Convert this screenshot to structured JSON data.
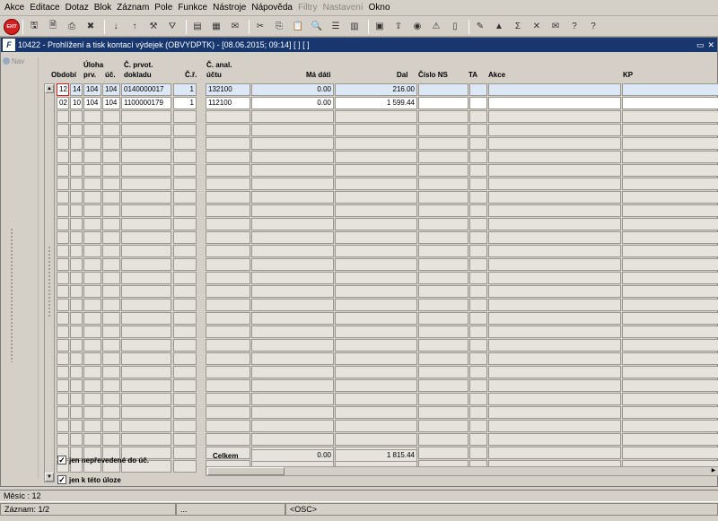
{
  "menu": [
    "Akce",
    "Editace",
    "Dotaz",
    "Blok",
    "Záznam",
    "Pole",
    "Funkce",
    "Nástroje",
    "Nápověda",
    "Filtry",
    "Nastavení",
    "Okno"
  ],
  "menu_disabled": [
    "Filtry",
    "Nastavení"
  ],
  "toolbar": {
    "exit_label": "EXIT",
    "icons": [
      "save-icon",
      "save-record-icon",
      "print-icon",
      "delete-icon",
      "sort-asc-icon",
      "sort-desc-icon",
      "tools-icon",
      "filter-icon",
      "document-icon",
      "document2-icon",
      "email-icon",
      "cut-icon",
      "copy-icon",
      "paste-icon",
      "zoom-icon",
      "list-icon",
      "detail-icon",
      "calc-icon",
      "export-icon",
      "web-icon",
      "warning-icon",
      "form-icon",
      "note-icon",
      "chart-icon",
      "sum-icon",
      "excel-icon",
      "mail-icon",
      "help-icon",
      "context-help-icon"
    ]
  },
  "window": {
    "title": "10422 - Prohlížení a tisk kontací výdejek (OBVYDPTK) - [08.06.2015; 09:14]  [ ]  [ ]",
    "logo": "F",
    "restore": "▭",
    "close": "✕"
  },
  "nav": {
    "label": "Nav"
  },
  "headers": {
    "obdobi": "Období",
    "uloha1": "Úloha",
    "uloha2": "prv.",
    "uloha3": "úč.",
    "cprvot1": "Č. prvot.",
    "cprvot2": "dokladu",
    "cr": "Č.ř.",
    "canal1": "Č. anal.",
    "canal2": "účtu",
    "madati": "Má dáti",
    "dal": "Dal",
    "cislons": "Číslo NS",
    "ta": "TA",
    "akce": "Akce",
    "kp": "KP"
  },
  "rows": [
    {
      "obdobi": "12",
      "a": "14",
      "b": "104",
      "c": "104",
      "doklad": "0140000017",
      "cr": "1",
      "ucet": "132100",
      "madati": "0.00",
      "dal": "216.00"
    },
    {
      "obdobi": "02",
      "a": "10",
      "b": "104",
      "c": "104",
      "doklad": "1100000179",
      "cr": "1",
      "ucet": "112100",
      "madati": "0.00",
      "dal": "1 599.44"
    }
  ],
  "total": {
    "label": "Celkem",
    "madati": "0.00",
    "dal": "1 815.44"
  },
  "checkboxes": [
    {
      "label": "jen nepřevedené do úč.",
      "checked": true
    },
    {
      "label": "jen k této úloze",
      "checked": true
    }
  ],
  "status": {
    "line1": "Měsíc : 12",
    "zaznam": "Záznam: 1/2",
    "dots": "...",
    "osc": "<OSC>"
  }
}
